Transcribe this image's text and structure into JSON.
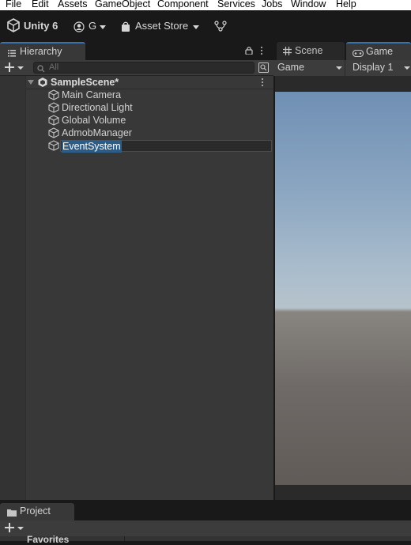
{
  "menu": [
    "File",
    "Edit",
    "Assets",
    "GameObject",
    "Component",
    "Services",
    "Jobs",
    "Window",
    "Help"
  ],
  "toolbar": {
    "unity_label": "Unity 6",
    "account_label": "G",
    "asset_store_label": "Asset Store"
  },
  "hierarchy": {
    "tab_label": "Hierarchy",
    "search_placeholder": "All",
    "scene_name": "SampleScene*",
    "objects": [
      "Main Camera",
      "Directional Light",
      "Global Volume",
      "AdmobManager",
      "EventSystem"
    ],
    "selected": "EventSystem"
  },
  "game_panel": {
    "scene_tab": "Scene",
    "game_tab": "Game",
    "mode_dropdown": "Game",
    "display_dropdown": "Display 1"
  },
  "project": {
    "tab_label": "Project",
    "favorites_label": "Favorites"
  },
  "colors": {
    "accent": "#3a72b0",
    "selection": "#2c5d87",
    "panel": "#383838"
  }
}
